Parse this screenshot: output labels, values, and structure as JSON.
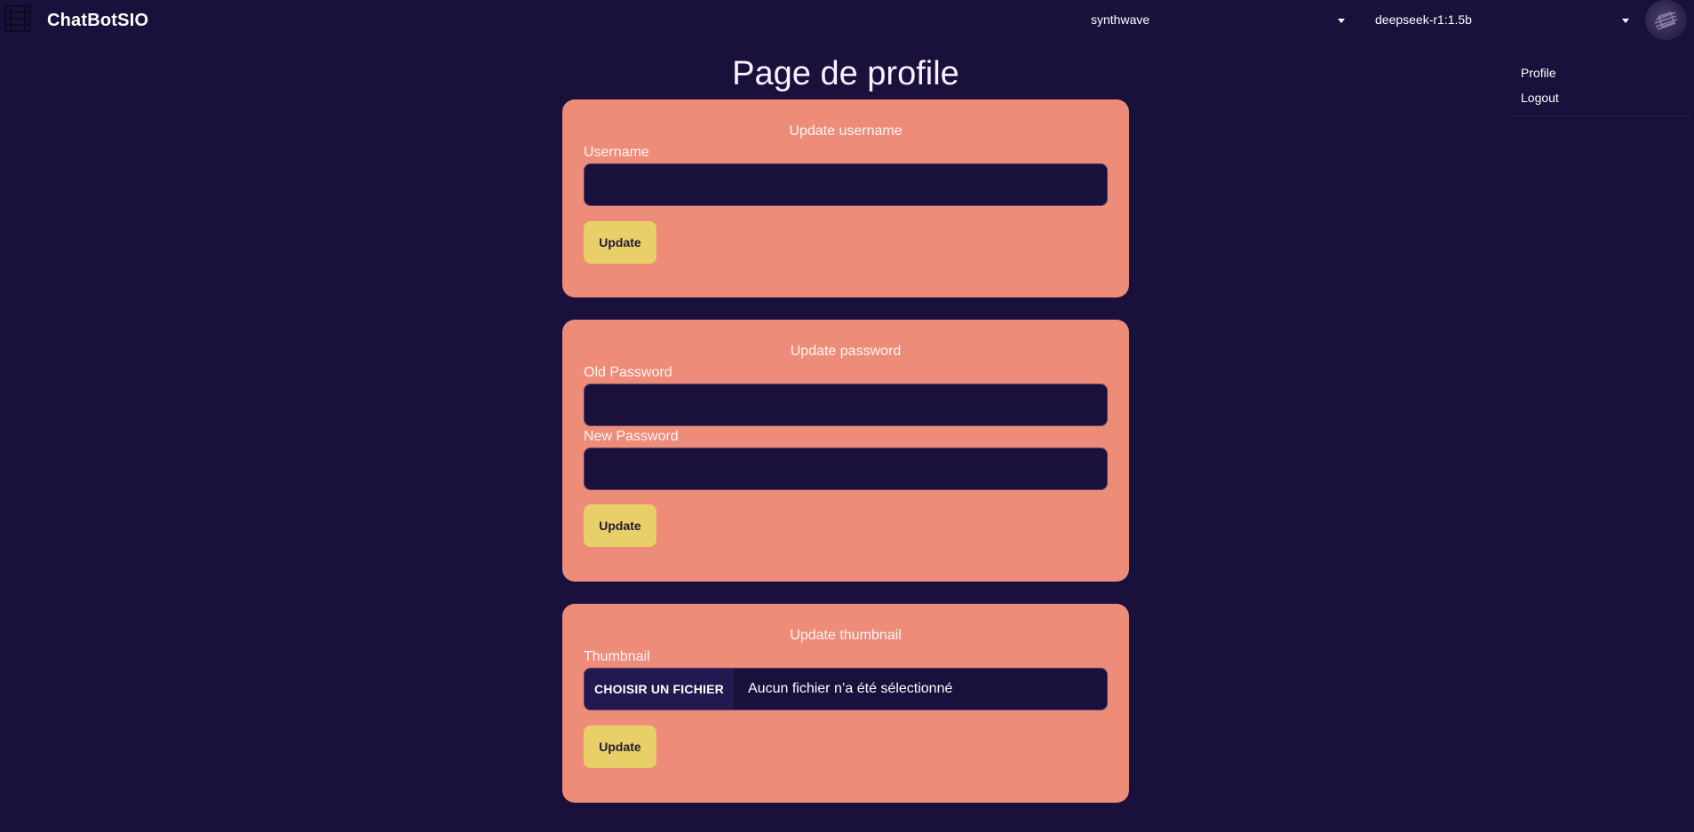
{
  "header": {
    "brand": "ChatBotSIO",
    "theme_select": {
      "value": "synthwave"
    },
    "model_select": {
      "value": "deepseek-r1:1.5b"
    }
  },
  "user_menu": {
    "items": [
      {
        "label": "Profile"
      },
      {
        "label": "Logout"
      }
    ]
  },
  "page": {
    "title": "Page de profile"
  },
  "username_card": {
    "title": "Update username",
    "field_label": "Username",
    "field_value": "",
    "button_label": "Update"
  },
  "password_card": {
    "title": "Update password",
    "old_label": "Old Password",
    "old_value": "",
    "new_label": "New Password",
    "new_value": "",
    "button_label": "Update"
  },
  "thumbnail_card": {
    "title": "Update thumbnail",
    "field_label": "Thumbnail",
    "file_button_label": "CHOISIR UN FICHIER",
    "file_status": "Aucun fichier n’a été sélectionné",
    "button_label": "Update"
  },
  "colors": {
    "background": "#1a103c",
    "card": "#ed8c79",
    "button": "#e9cf68",
    "input": "#1a103c"
  }
}
